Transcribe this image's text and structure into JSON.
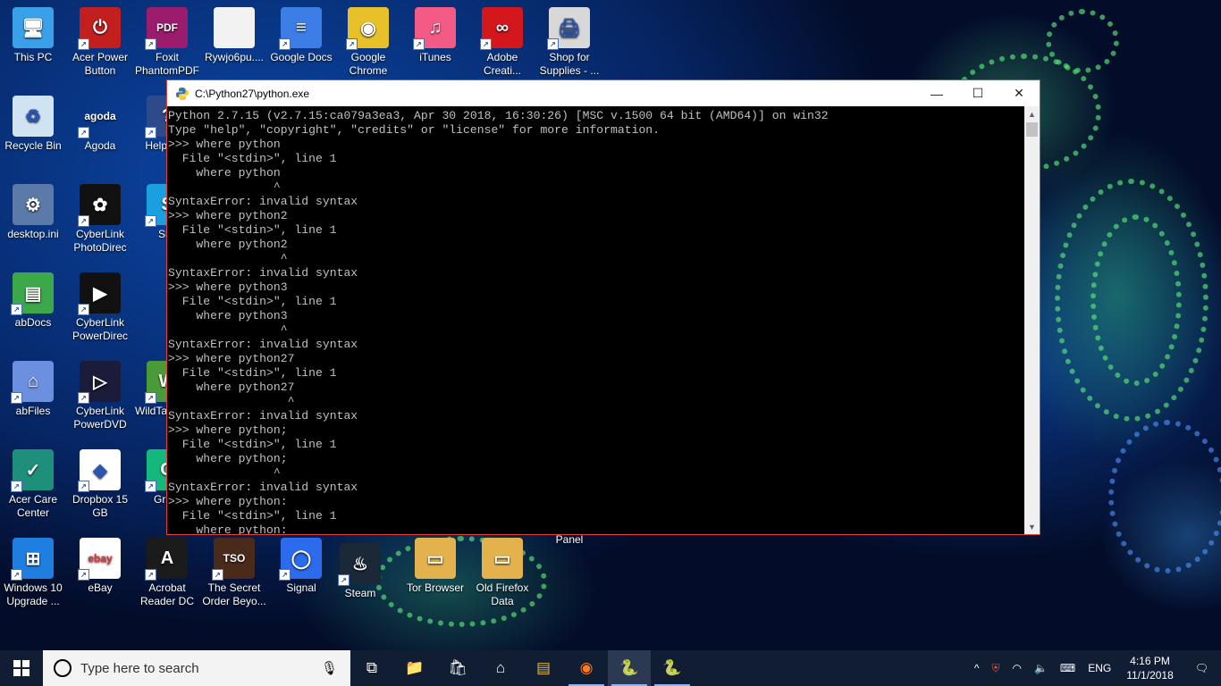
{
  "desktop": {
    "icons": [
      {
        "label": "This PC",
        "icon": "computer-icon"
      },
      {
        "label": "Acer Power Button",
        "icon": "power-icon"
      },
      {
        "label": "Foxit PhantomPDF",
        "icon": "pdf-icon"
      },
      {
        "label": "Rywjo6pu....",
        "icon": "file-icon"
      },
      {
        "label": "Google Docs",
        "icon": "docs-icon"
      },
      {
        "label": "Google Chrome",
        "icon": "chrome-icon"
      },
      {
        "label": "iTunes",
        "icon": "itunes-icon"
      },
      {
        "label": "Adobe Creati...",
        "icon": "adobe-cc-icon"
      },
      {
        "label": "Shop for Supplies - ...",
        "icon": "printer-icon"
      },
      {
        "label": "Recycle Bin",
        "icon": "recycle-bin-icon"
      },
      {
        "label": "Agoda",
        "icon": "agoda-icon"
      },
      {
        "label": "Help Sup",
        "icon": "help-icon"
      },
      {
        "label": "desktop.ini",
        "icon": "settings-file-icon"
      },
      {
        "label": "CyberLink PhotoDirec",
        "icon": "photodirector-icon"
      },
      {
        "label": "Sky",
        "icon": "skype-icon"
      },
      {
        "label": "abDocs",
        "icon": "abdocs-icon"
      },
      {
        "label": "CyberLink PowerDirec",
        "icon": "powerdirector-icon"
      },
      {
        "label": "abFiles",
        "icon": "abfiles-icon"
      },
      {
        "label": "CyberLink PowerDVD 12",
        "icon": "powerdvd-icon"
      },
      {
        "label": "WildTa Game",
        "icon": "wildtangent-icon"
      },
      {
        "label": "Acer Care Center",
        "icon": "acer-care-icon"
      },
      {
        "label": "Dropbox 15 GB",
        "icon": "dropbox-icon"
      },
      {
        "label": "Gram",
        "icon": "grammarly-icon"
      },
      {
        "label": "Windows 10 Upgrade ...",
        "icon": "windows-icon"
      },
      {
        "label": "eBay",
        "icon": "ebay-icon"
      },
      {
        "label": "Acrobat Reader DC",
        "icon": "acrobat-icon"
      },
      {
        "label": "The Secret Order Beyo...",
        "icon": "game-icon"
      },
      {
        "label": "Signal",
        "icon": "signal-icon"
      },
      {
        "label": "Steam",
        "icon": "steam-icon"
      },
      {
        "label": "Tor Browser",
        "icon": "folder-icon"
      },
      {
        "label": "Old Firefox Data",
        "icon": "folder-icon"
      },
      {
        "label": "Panel",
        "icon": "none"
      }
    ]
  },
  "window": {
    "title": "C:\\Python27\\python.exe",
    "controls": {
      "minimize": "—",
      "maximize": "☐",
      "close": "✕"
    },
    "console_lines": [
      "Python 2.7.15 (v2.7.15:ca079a3ea3, Apr 30 2018, 16:30:26) [MSC v.1500 64 bit (AMD64)] on win32",
      "Type \"help\", \"copyright\", \"credits\" or \"license\" for more information.",
      ">>> where python",
      "  File \"<stdin>\", line 1",
      "    where python",
      "               ^",
      "SyntaxError: invalid syntax",
      ">>> where python2",
      "  File \"<stdin>\", line 1",
      "    where python2",
      "                ^",
      "SyntaxError: invalid syntax",
      ">>> where python3",
      "  File \"<stdin>\", line 1",
      "    where python3",
      "                ^",
      "SyntaxError: invalid syntax",
      ">>> where python27",
      "  File \"<stdin>\", line 1",
      "    where python27",
      "                 ^",
      "SyntaxError: invalid syntax",
      ">>> where python;",
      "  File \"<stdin>\", line 1",
      "    where python;",
      "               ^",
      "SyntaxError: invalid syntax",
      ">>> where python:",
      "  File \"<stdin>\", line 1",
      "    where python:"
    ]
  },
  "taskbar": {
    "search_placeholder": "Type here to search",
    "apps": [
      {
        "name": "task-view-icon",
        "glyph": "⧉"
      },
      {
        "name": "file-explorer-icon",
        "glyph": "📁"
      },
      {
        "name": "store-icon",
        "glyph": "🛍"
      },
      {
        "name": "home-icon",
        "glyph": "⌂"
      },
      {
        "name": "archive-icon",
        "glyph": "▤"
      },
      {
        "name": "firefox-icon",
        "glyph": "◉"
      },
      {
        "name": "python-icon",
        "glyph": "🐍"
      },
      {
        "name": "python-launcher-icon",
        "glyph": "🐍"
      }
    ],
    "tray": {
      "chevron": "^",
      "language": "ENG",
      "time": "4:16 PM",
      "date": "11/1/2018"
    }
  }
}
